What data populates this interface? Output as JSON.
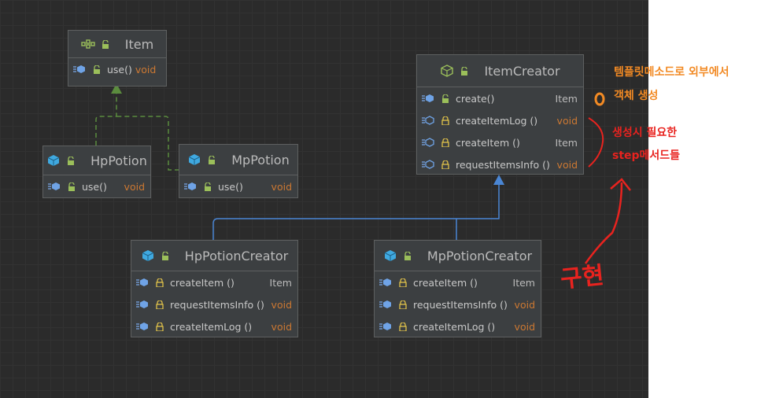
{
  "colors": {
    "canvas": "#2b2b2b",
    "node_fill": "#3c3f41",
    "node_border": "#5e6060",
    "void_type": "#cc7832",
    "inherit_arrow": "#5b8c3e",
    "implement_arrow": "#4a86d4",
    "note_orange": "#f28a24",
    "note_red": "#e8231f"
  },
  "nodes": {
    "item": {
      "title": "Item",
      "kind": "interface",
      "methods": [
        {
          "name": "use()",
          "type": "void"
        }
      ]
    },
    "hp_potion": {
      "title": "HpPotion",
      "kind": "class",
      "methods": [
        {
          "name": "use()",
          "type": "void"
        }
      ]
    },
    "mp_potion": {
      "title": "MpPotion",
      "kind": "class",
      "methods": [
        {
          "name": "use()",
          "type": "void"
        }
      ]
    },
    "item_creator": {
      "title": "ItemCreator",
      "kind": "abstract-class",
      "methods": [
        {
          "name": "create()",
          "type": "Item"
        },
        {
          "name": "createItemLog ()",
          "type": "void"
        },
        {
          "name": "createItem ()",
          "type": "Item"
        },
        {
          "name": "requestItemsInfo ()",
          "type": "void"
        }
      ]
    },
    "hp_potion_creator": {
      "title": "HpPotionCreator",
      "kind": "class",
      "methods": [
        {
          "name": "createItem ()",
          "type": "Item"
        },
        {
          "name": "requestItemsInfo ()",
          "type": "void"
        },
        {
          "name": "createItemLog ()",
          "type": "void"
        }
      ]
    },
    "mp_potion_creator": {
      "title": "MpPotionCreator",
      "kind": "class",
      "methods": [
        {
          "name": "createItem ()",
          "type": "Item"
        },
        {
          "name": "requestItemsInfo ()",
          "type": "void"
        },
        {
          "name": "createItemLog ()",
          "type": "void"
        }
      ]
    }
  },
  "annotations": {
    "template_method_line1": "템플릿메소드로 외부에서",
    "template_method_line2": "객체 생성",
    "step_line1": "생성시 필요한",
    "step_line2": "step메서드들",
    "handwritten": "구현"
  }
}
